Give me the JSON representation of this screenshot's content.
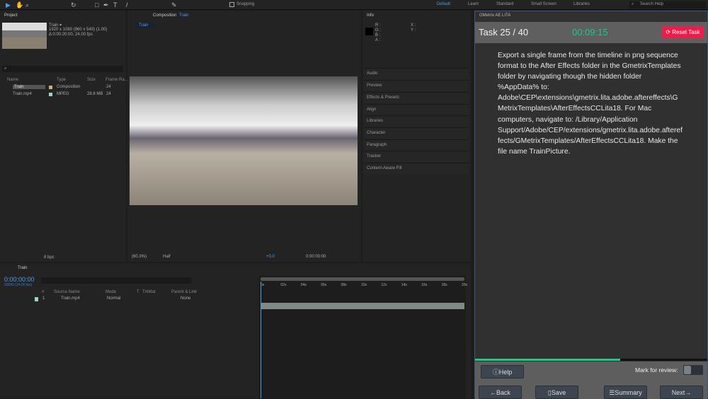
{
  "toolbar": {
    "snapping": "Snapping",
    "workspaces": [
      "Default",
      "Learn",
      "Standard",
      "Small Screen",
      "Libraries"
    ],
    "search_placeholder": "Search Help"
  },
  "project": {
    "title": "Project",
    "comp_name": "Train ▾",
    "comp_dims": "1920 x 1080  (960 x 540) (1.00)",
    "comp_duration": "Δ 0:00:20:00, 24.00 fps",
    "bpc": "8 bpc",
    "columns": [
      "Name",
      "Type",
      "Size",
      "Frame Ra..."
    ],
    "items": [
      {
        "name": "Train",
        "type": "Composition",
        "size": "",
        "fps": "24",
        "color": "#c9b07a"
      },
      {
        "name": "Train.mp4",
        "type": "MPEG",
        "size": "28.8 MB",
        "fps": "24",
        "color": "#9ad5c8"
      }
    ]
  },
  "composition": {
    "title": "Composition",
    "comp": "Train",
    "tab": "Train",
    "zoom": "(60.3%)",
    "resolution": "Half",
    "exposure": "+0.0",
    "timecode": "0:00:00:00"
  },
  "info": {
    "title": "Info",
    "labels": [
      "R :",
      "G :",
      "B :",
      "A :"
    ],
    "xy": [
      "X :",
      "Y :"
    ]
  },
  "side_panels": [
    "Audio",
    "Preview",
    "Effects & Presets",
    "Align",
    "Libraries",
    "Character",
    "Paragraph",
    "Tracker",
    "Content-Aware Fill"
  ],
  "timeline": {
    "tab": "Train",
    "timecode": "0:00:00:00",
    "frames": "00000 (24.00 fps)",
    "columns": [
      "#",
      "Source Name",
      "Mode",
      "T",
      "TrkMat",
      "Parent & Link"
    ],
    "layer": {
      "index": "1",
      "name": "Train.mp4",
      "mode": "Normal",
      "parent": "None"
    },
    "ticks": [
      "0s",
      "02s",
      "04s",
      "06s",
      "08s",
      "10s",
      "12s",
      "14s",
      "16s",
      "18s",
      "20s"
    ]
  },
  "gmetrix": {
    "title": "GMetrix AE LITA",
    "task": "Task 25 / 40",
    "timer": "00:09:15",
    "reset": "Reset Task",
    "instructions": "Export a single frame from the timeline in png sequence format to the After Effects folder in the GmetrixTemplates folder by navigating though the hidden folder %AppData% to: Adobe\\CEP\\extensions\\gmetrix.lita.adobe.aftereffects\\GMetrixTemplates\\AfterEffectsCCLita18. For Mac computers, navigate to: /Library/Application Support/Adobe/CEP/extensions/gmetrix.lita.adobe.aftereffects/GMetrixTemplates/AfterEffectsCCLita18. Make the file name TrainPicture.",
    "progress": 0.625,
    "help": "Help",
    "mark_review": "Mark for review:",
    "back": "Back",
    "save": "Save",
    "summary": "Summary",
    "next": "Next",
    "accent": "#1dc888",
    "reset_color": "#ee1c4a"
  }
}
